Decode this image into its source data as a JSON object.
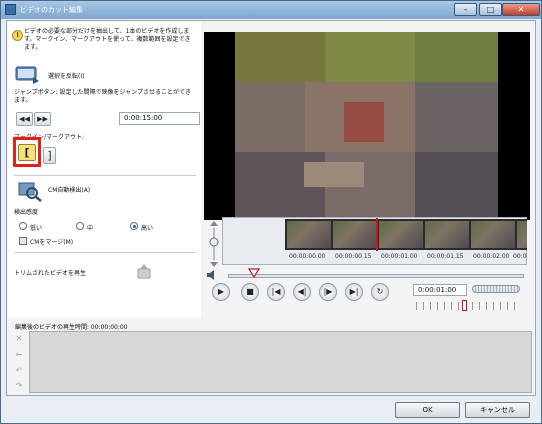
{
  "window": {
    "title": "ビデオのカット編集",
    "minimize_icon": "minimize-icon",
    "maximize_icon": "maximize-icon",
    "close_icon": "close-icon"
  },
  "left_panel": {
    "hint_text": "ビデオの必要な部分だけを抽出して、1本のビデオを作成します。マークイン、マークアウトを使って、複数範囲を設定できます。",
    "invert_selection_label": "選択を反転(I)",
    "jump_description": "ジャンプボタン: 設定した間隔で映像をジャンプさせることができます。",
    "jump_interval_value": "0:00:15:00",
    "mark_in_out_label": "マークイン/マークアウト:",
    "cm_detect_label": "CM自動検出(A)",
    "sensitivity_label": "検出感度",
    "sensitivity_options": [
      {
        "label": "低い",
        "selected": false
      },
      {
        "label": "中",
        "selected": false
      },
      {
        "label": "高い",
        "selected": true
      }
    ],
    "merge_cm_label": "CMをマージ(M)",
    "play_trimmed_label": "トリムされたビデオを再生"
  },
  "timeline": {
    "ticks": [
      "00:00:00.00",
      "00:00:00.15",
      "00:00:01.00",
      "00:00:01.15",
      "00:00:02.00",
      "00:00"
    ]
  },
  "controls": {
    "timecode": "0:00:01:00"
  },
  "edit_area": {
    "duration_label": "編集後のビデオの再生時間: 00:00:00:00"
  },
  "buttons": {
    "ok": "OK",
    "cancel": "キャンセル"
  },
  "colors": {
    "highlight": "#e0221b",
    "titlebar": "#7fa6cf"
  }
}
